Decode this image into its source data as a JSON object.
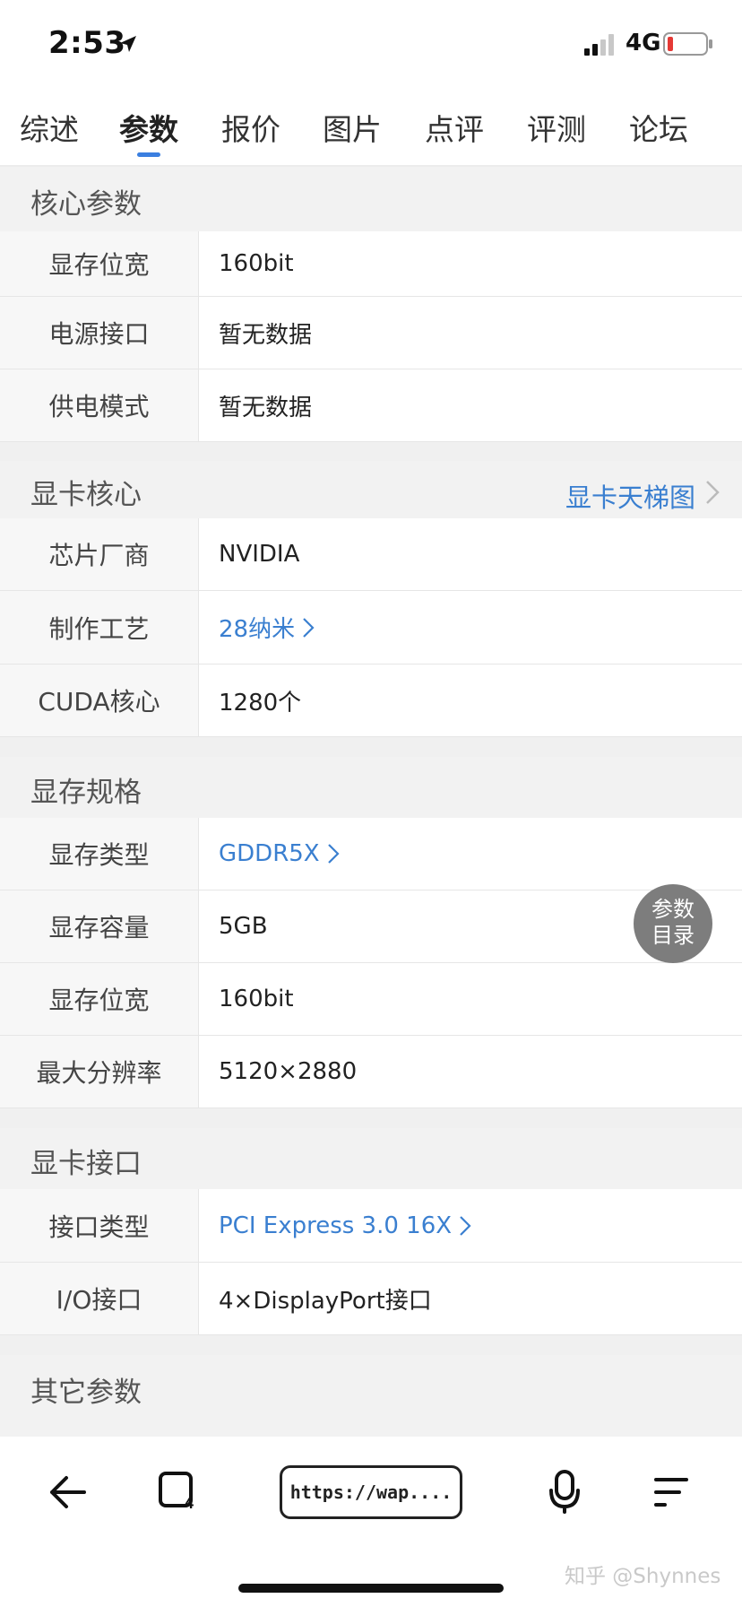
{
  "status": {
    "time": "2:53",
    "network": "4G"
  },
  "tabs": [
    {
      "label": "综述",
      "active": false
    },
    {
      "label": "参数",
      "active": true
    },
    {
      "label": "报价",
      "active": false
    },
    {
      "label": "图片",
      "active": false
    },
    {
      "label": "点评",
      "active": false
    },
    {
      "label": "评测",
      "active": false
    },
    {
      "label": "论坛",
      "active": false
    }
  ],
  "sections": [
    {
      "title": "核心参数",
      "rows": [
        {
          "label": "显存位宽",
          "value": "160bit",
          "link": false
        },
        {
          "label": "电源接口",
          "value": "暂无数据",
          "link": false
        },
        {
          "label": "供电模式",
          "value": "暂无数据",
          "link": false
        }
      ]
    },
    {
      "title": "显卡核心",
      "link": "显卡天梯图",
      "rows": [
        {
          "label": "芯片厂商",
          "value": "NVIDIA",
          "link": false
        },
        {
          "label": "制作工艺",
          "value": "28纳米",
          "link": true
        },
        {
          "label": "CUDA核心",
          "value": "1280个",
          "link": false
        }
      ]
    },
    {
      "title": "显存规格",
      "rows": [
        {
          "label": "显存类型",
          "value": "GDDR5X",
          "link": true
        },
        {
          "label": "显存容量",
          "value": "5GB",
          "link": false
        },
        {
          "label": "显存位宽",
          "value": "160bit",
          "link": false
        },
        {
          "label": "最大分辨率",
          "value": "5120×2880",
          "link": false
        }
      ]
    },
    {
      "title": "显卡接口",
      "rows": [
        {
          "label": "接口类型",
          "value": "PCI Express 3.0 16X",
          "link": true
        },
        {
          "label": "I/O接口",
          "value": "4×DisplayPort接口",
          "link": false
        }
      ]
    },
    {
      "title": "其它参数",
      "rows": []
    }
  ],
  "float_button": {
    "line1": "参数",
    "line2": "目录"
  },
  "toolbar": {
    "url": "https://wap...."
  },
  "watermark": "知乎 @Shynnes",
  "colors": {
    "link": "#3a7fd0",
    "tab_indicator": "#3b7fe0",
    "battery_low": "#e53935"
  }
}
